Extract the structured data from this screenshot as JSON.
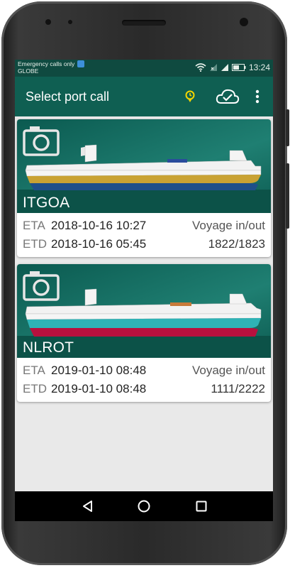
{
  "status_bar": {
    "line1": "Emergency calls only",
    "line2": "GLOBE",
    "time": "13:24"
  },
  "app_bar": {
    "title": "Select port call"
  },
  "port_calls": [
    {
      "code": "ITGOA",
      "eta_label": "ETA",
      "eta": "2018-10-16 10:27",
      "etd_label": "ETD",
      "etd": "2018-10-16 05:45",
      "voyage_label": "Voyage in/out",
      "voyage": "1822/1823",
      "hull_color": "#c9a233",
      "keel_color": "#1e4f8a"
    },
    {
      "code": "NLROT",
      "eta_label": "ETA",
      "eta": "2019-01-10 08:48",
      "etd_label": "ETD",
      "etd": "2019-01-10 08:48",
      "voyage_label": "Voyage in/out",
      "voyage": "1111/2222",
      "hull_color": "#2fb3b6",
      "keel_color": "#b8103e"
    }
  ],
  "colors": {
    "app_bar": "#0f5f52",
    "status_bar": "#0f4a40",
    "clock_accent": "#f2d400"
  },
  "icons": {
    "card_camera": "camera-icon",
    "app_clock": "clock-icon",
    "app_sync": "cloud-check-icon",
    "app_menu": "more-vert-icon",
    "nav_back": "back-icon",
    "nav_home": "home-icon",
    "nav_recents": "recents-icon"
  }
}
